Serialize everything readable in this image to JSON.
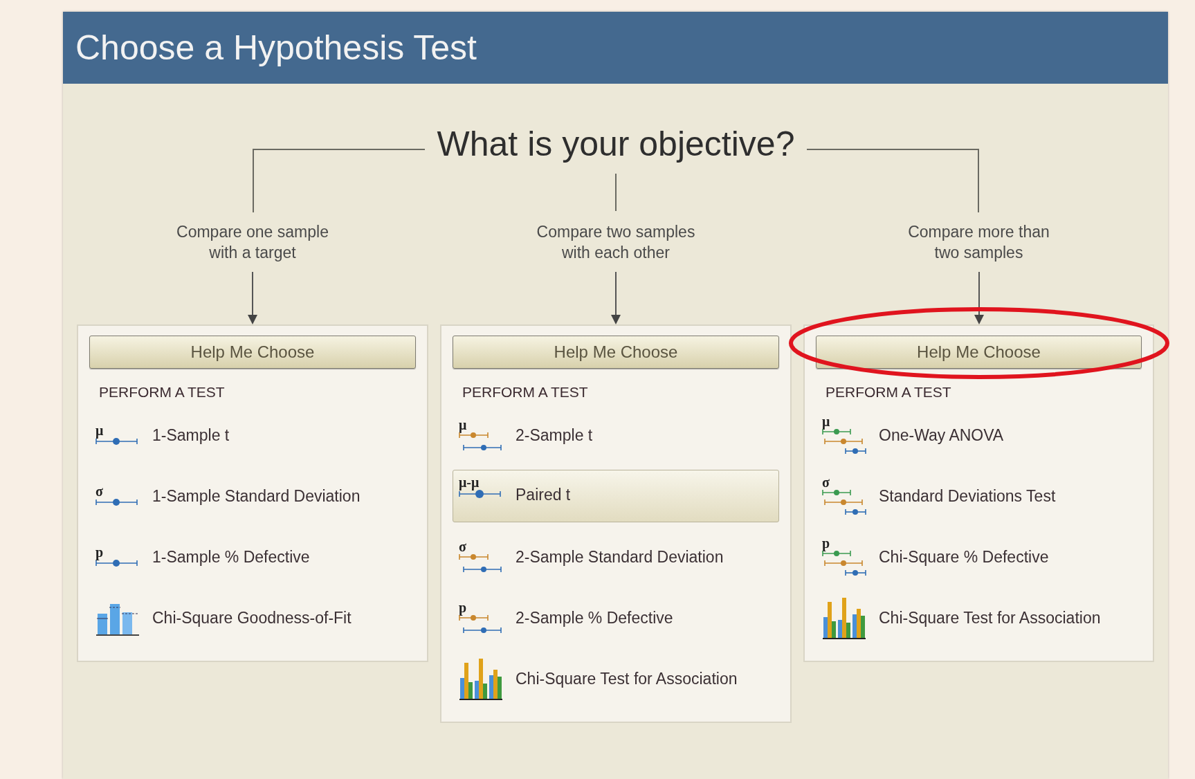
{
  "window": {
    "title": "Choose a Hypothesis Test"
  },
  "objective": {
    "heading": "What is your objective?"
  },
  "columns": [
    {
      "label_lines": [
        "Compare one sample",
        "with a target"
      ],
      "circled": false,
      "panel": {
        "button": "Help Me Choose",
        "section": "PERFORM A TEST",
        "items": [
          {
            "kind": "single",
            "symbol": "μ",
            "label": "1-Sample t",
            "selected": false
          },
          {
            "kind": "single",
            "symbol": "σ",
            "label": "1-Sample Standard Deviation",
            "selected": false
          },
          {
            "kind": "single",
            "symbol": "p",
            "label": "1-Sample % Defective",
            "selected": false
          },
          {
            "kind": "histogram",
            "label": "Chi-Square Goodness-of-Fit",
            "selected": false
          }
        ]
      }
    },
    {
      "label_lines": [
        "Compare two samples",
        "with each other"
      ],
      "circled": false,
      "panel": {
        "button": "Help Me Choose",
        "section": "PERFORM A TEST",
        "items": [
          {
            "kind": "pair",
            "symbol": "μ",
            "label": "2-Sample t",
            "selected": false
          },
          {
            "kind": "paired",
            "symbol": "μ-μ",
            "label": "Paired t",
            "selected": true
          },
          {
            "kind": "pair",
            "symbol": "σ",
            "label": "2-Sample Standard Deviation",
            "selected": false
          },
          {
            "kind": "pair",
            "symbol": "p",
            "label": "2-Sample % Defective",
            "selected": false
          },
          {
            "kind": "barchart",
            "label": "Chi-Square Test for Association",
            "selected": false
          }
        ]
      }
    },
    {
      "label_lines": [
        "Compare more than",
        "two samples"
      ],
      "circled": true,
      "panel": {
        "button": "Help Me Choose",
        "section": "PERFORM A TEST",
        "items": [
          {
            "kind": "triple",
            "symbol": "μ",
            "label": "One-Way ANOVA",
            "selected": false
          },
          {
            "kind": "triple",
            "symbol": "σ",
            "label": "Standard Deviations Test",
            "selected": false
          },
          {
            "kind": "triple",
            "symbol": "p",
            "label": "Chi-Square % Defective",
            "selected": false
          },
          {
            "kind": "barchart",
            "label": "Chi-Square Test for Association",
            "selected": false
          }
        ]
      }
    }
  ]
}
